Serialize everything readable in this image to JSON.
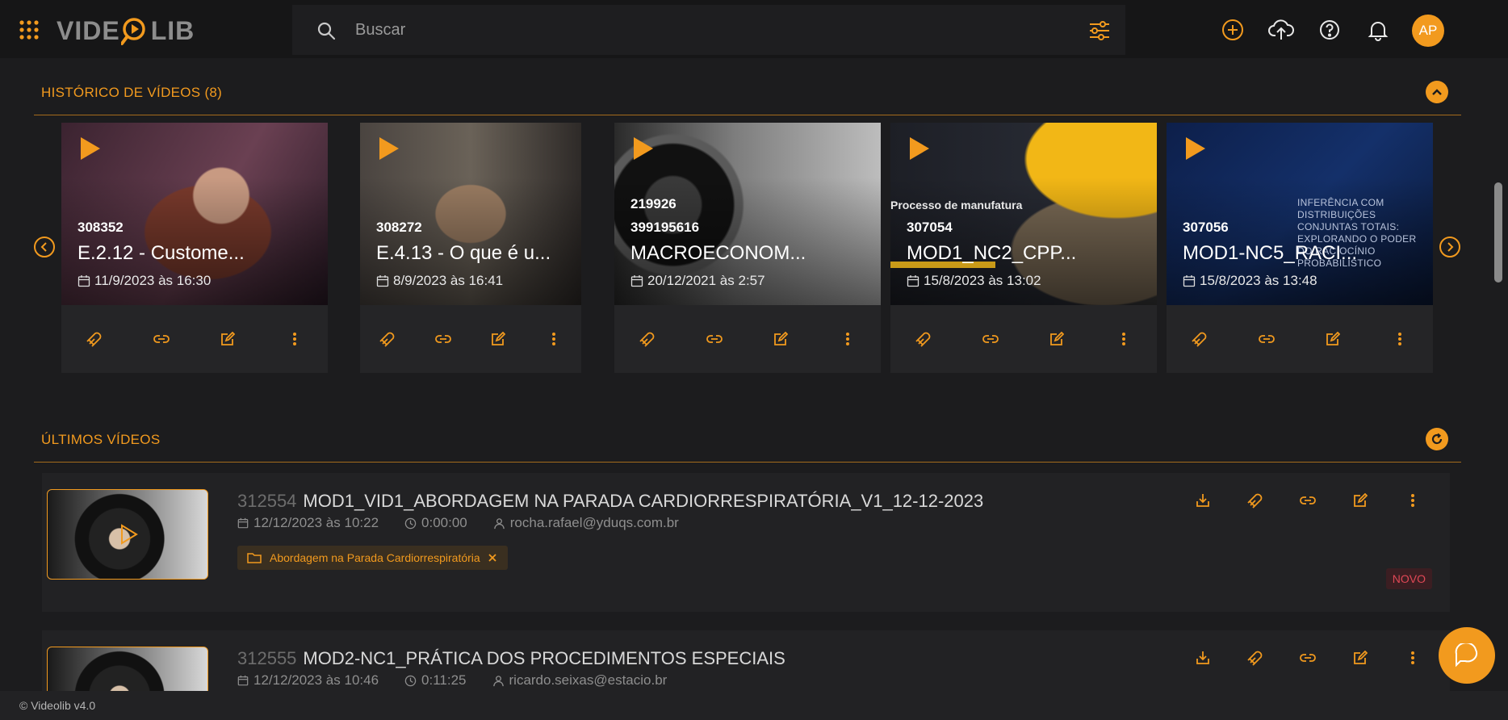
{
  "app": {
    "logo_text_left": "VIDE",
    "logo_text_right": "LIB"
  },
  "search": {
    "placeholder": "Buscar"
  },
  "user": {
    "initials": "AP"
  },
  "history": {
    "title": "HISTÓRICO DE VÍDEOS (8)",
    "cards": [
      {
        "id": "308352",
        "title": "E.2.12 - Custome...",
        "date": "11/9/2023 às 16:30"
      },
      {
        "id": "308272",
        "title": "E.4.13 - O que é u...",
        "date": "8/9/2023 às 16:41"
      },
      {
        "id_top": "219926",
        "id": "399195616",
        "title": "MACROECONOM...",
        "date": "20/12/2021 às 2:57"
      },
      {
        "id": "307054",
        "title": "MOD1_NC2_CPP...",
        "date": "15/8/2023 às 13:02",
        "overlay": "Processo de manufatura"
      },
      {
        "id": "307056",
        "title": "MOD1-NC5_RACI...",
        "date": "15/8/2023 às 13:48",
        "overlay": "INFERÊNCIA COM DISTRIBUIÇÕES CONJUNTAS TOTAIS: EXPLORANDO O PODER DO RACIOCÍNIO PROBABILÍSTICO"
      }
    ]
  },
  "latest": {
    "title": "ÚLTIMOS VÍDEOS",
    "rows": [
      {
        "id": "312554",
        "title": "MOD1_VID1_ABORDAGEM NA PARADA CARDIORRESPIRATÓRIA_V1_12-12-2023",
        "date": "12/12/2023 às 10:22",
        "duration": "0:00:00",
        "user": "rocha.rafael@yduqs.com.br",
        "folder": "Abordagem na Parada Cardiorrespiratória",
        "badge": "NOVO"
      },
      {
        "id": "312555",
        "title": "MOD2-NC1_PRÁTICA DOS PROCEDIMENTOS ESPECIAIS",
        "date": "12/12/2023 às 10:46",
        "duration": "0:11:25",
        "user": "ricardo.seixas@estacio.br"
      }
    ]
  },
  "footer": {
    "text": "© Videolib v4.0"
  },
  "colors": {
    "accent": "#f29a1e",
    "background": "#1c1c1e",
    "badge_new": "#e04856"
  }
}
